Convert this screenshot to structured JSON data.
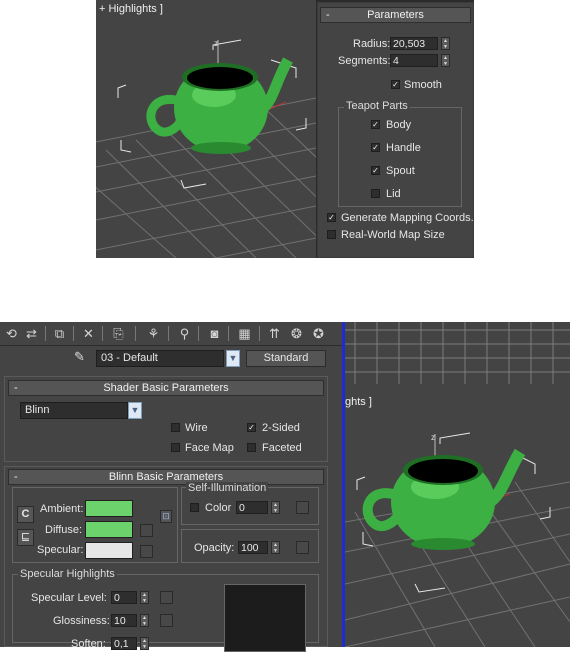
{
  "top_viewport": {
    "label": "+ Highlights ]"
  },
  "parameters": {
    "title": "Parameters",
    "collapse": "-",
    "radius_label": "Radius:",
    "radius_value": "20,503",
    "segments_label": "Segments:",
    "segments_value": "4",
    "smooth_label": "Smooth",
    "teapot_parts_label": "Teapot Parts",
    "parts": [
      "Body",
      "Handle",
      "Spout",
      "Lid"
    ],
    "parts_checked": [
      true,
      true,
      true,
      false
    ],
    "generate_mapping_label": "Generate Mapping Coords.",
    "real_world_label": "Real-World Map Size"
  },
  "material_editor": {
    "material_name": "03 - Default",
    "material_type": "Standard",
    "shader_basic": {
      "title": "Shader Basic Parameters",
      "collapse": "-",
      "shader": "Blinn",
      "wire_label": "Wire",
      "two_sided_label": "2-Sided",
      "face_map_label": "Face Map",
      "faceted_label": "Faceted"
    },
    "blinn_basic": {
      "title": "Blinn Basic Parameters",
      "collapse": "-",
      "lock_c": "C",
      "ambient_label": "Ambient:",
      "diffuse_label": "Diffuse:",
      "specular_label": "Specular:",
      "self_illum_label": "Self-Illumination",
      "color_label": "Color",
      "color_value": "0",
      "opacity_label": "Opacity:",
      "opacity_value": "100"
    },
    "specular_highlights": {
      "title": "Specular Highlights",
      "level_label": "Specular Level:",
      "level_value": "0",
      "gloss_label": "Glossiness:",
      "gloss_value": "10",
      "soften_label": "Soften:",
      "soften_value": "0,1"
    }
  },
  "bottom_viewport": {
    "label": "ghts ]"
  },
  "colors": {
    "ambient": "#6cd36c",
    "diffuse": "#6cd36c",
    "specular": "#e6e6e6",
    "teapot": "#3cb043",
    "viewport_bg": "#444444",
    "blue_divider": "#1c2bd6"
  }
}
